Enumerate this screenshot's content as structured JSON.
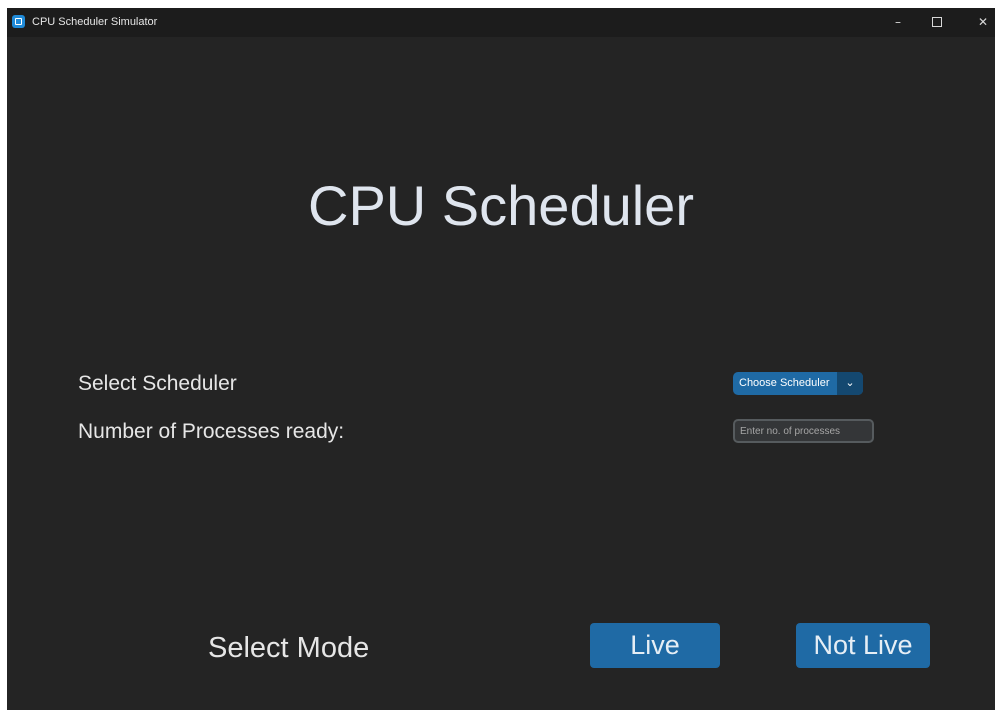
{
  "window": {
    "title": "CPU Scheduler Simulator",
    "controls": {
      "minimize": "–",
      "close": "✕"
    }
  },
  "main": {
    "heading": "CPU Scheduler",
    "scheduler": {
      "label": "Select Scheduler",
      "dropdown_value": "Choose Scheduler",
      "dropdown_arrow": "⌄"
    },
    "processes": {
      "label": "Number of Processes ready:",
      "placeholder": "Enter no. of processes",
      "value": ""
    },
    "mode": {
      "label": "Select Mode",
      "live_label": "Live",
      "not_live_label": "Not Live"
    }
  },
  "colors": {
    "background": "#242424",
    "titlebar": "#1c1c1c",
    "accent": "#1f6aa5",
    "accent_dark": "#144870",
    "heading_text": "#dfe5ee"
  },
  "icons": {
    "app": "app-logo-icon",
    "dropdown": "chevron-down-icon",
    "maximize": "maximize-icon"
  }
}
